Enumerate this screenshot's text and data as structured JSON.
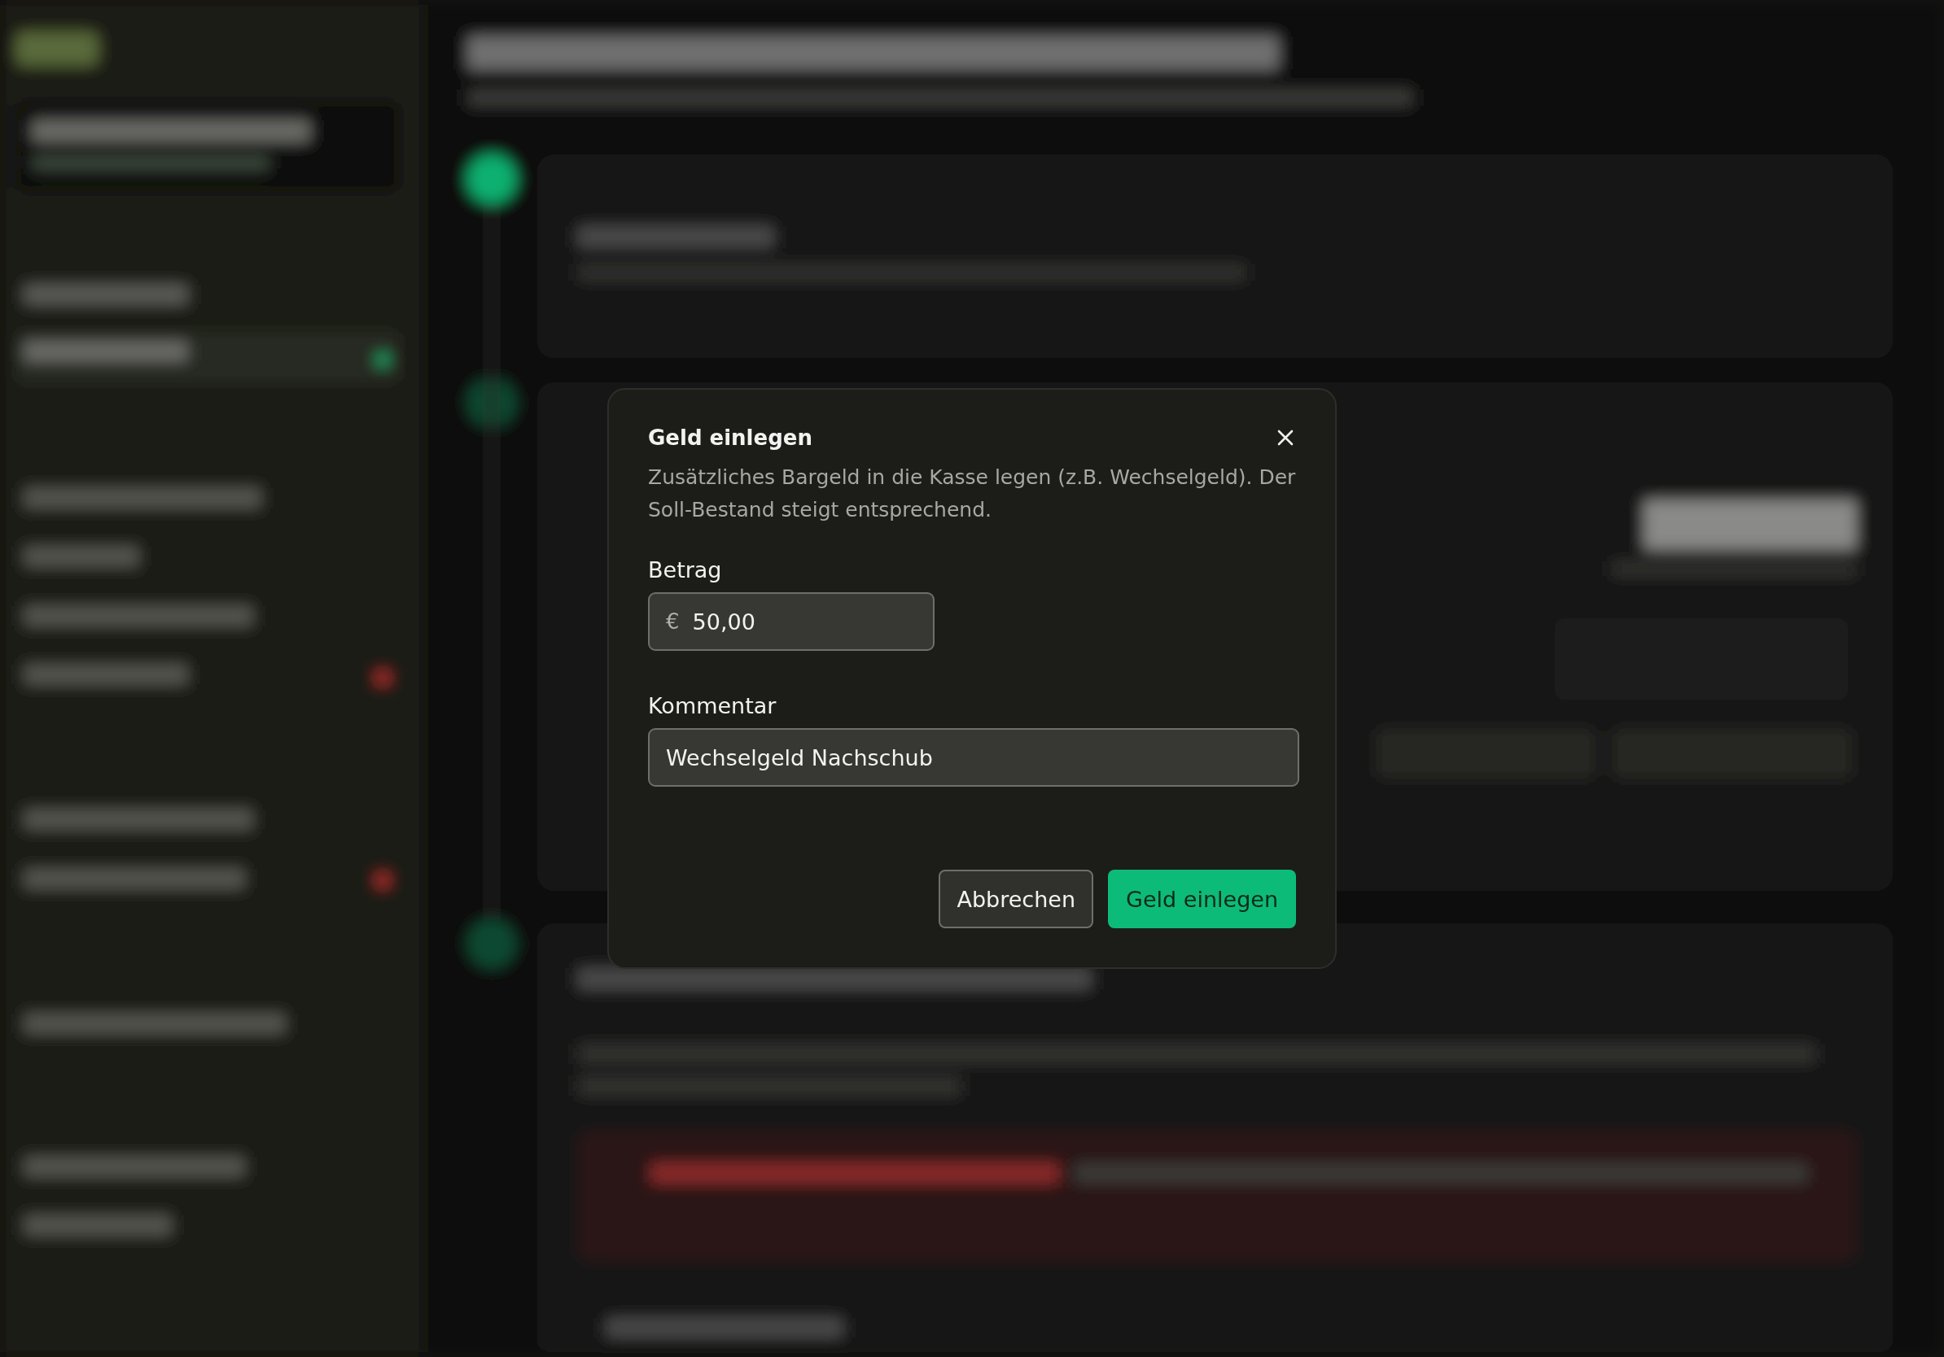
{
  "dialog": {
    "title": "Geld einlegen",
    "description": "Zusätzliches Bargeld in die Kasse legen (z.B. Wechselgeld). Der Soll-Bestand steigt entsprechend.",
    "fields": [
      {
        "label": "Betrag",
        "prefix": "€",
        "value": "50,00",
        "kind": "amount"
      },
      {
        "label": "Kommentar",
        "value": "Wechselgeld Nachschub",
        "kind": "text"
      }
    ],
    "buttons": [
      {
        "label": "Abbrechen",
        "kind": "secondary"
      },
      {
        "label": "Geld einlegen",
        "kind": "primary"
      }
    ]
  }
}
